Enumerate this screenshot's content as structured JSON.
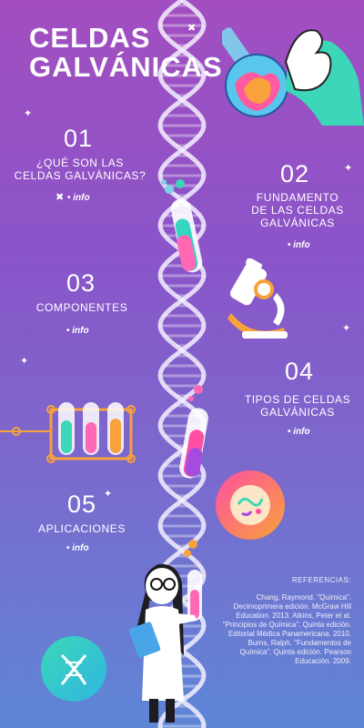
{
  "title": [
    "CELDAS",
    "GALVÁNICAS"
  ],
  "sections": [
    {
      "number": "01",
      "label_lines": [
        "¿QUÉ SON LAS",
        "CELDAS GALVÁNICAS?"
      ],
      "link": "info"
    },
    {
      "number": "02",
      "label_lines": [
        "FUNDAMENTO",
        "DE LAS CELDAS",
        "GALVÁNICAS"
      ],
      "link": "info"
    },
    {
      "number": "03",
      "label_lines": [
        "COMPONENTES"
      ],
      "link": "info"
    },
    {
      "number": "04",
      "label_lines": [
        "TIPOS DE CELDAS",
        "GALVÁNICAS"
      ],
      "link": "info"
    },
    {
      "number": "05",
      "label_lines": [
        "APLICACIONES"
      ],
      "link": "info"
    }
  ],
  "references": {
    "heading": "REFERENCIAS:",
    "text": "Chang, Raymond. \"Química\". Decimoprimera edición. McGraw Hill Education. 2013. Atkins, Peter et al. \"Principios de Química\". Quinta edición. Editorial Médica Panamericana. 2010. Burns, Ralph. \"Fundamentos de Química\". Quinta edición. Pearson Educación. 2009."
  },
  "icons": [
    "dna-helix-icon",
    "flask-hand-icon",
    "test-tube-icon",
    "microscope-icon",
    "test-tube-rack-icon",
    "bacteria-petri-icon",
    "scientist-illustration",
    "dna-badge-icon"
  ],
  "colors": {
    "bg_top": "#a24ec0",
    "bg_bottom": "#5e86d6",
    "accent_orange": "#f7a23b",
    "accent_pink": "#ff3f8e"
  }
}
